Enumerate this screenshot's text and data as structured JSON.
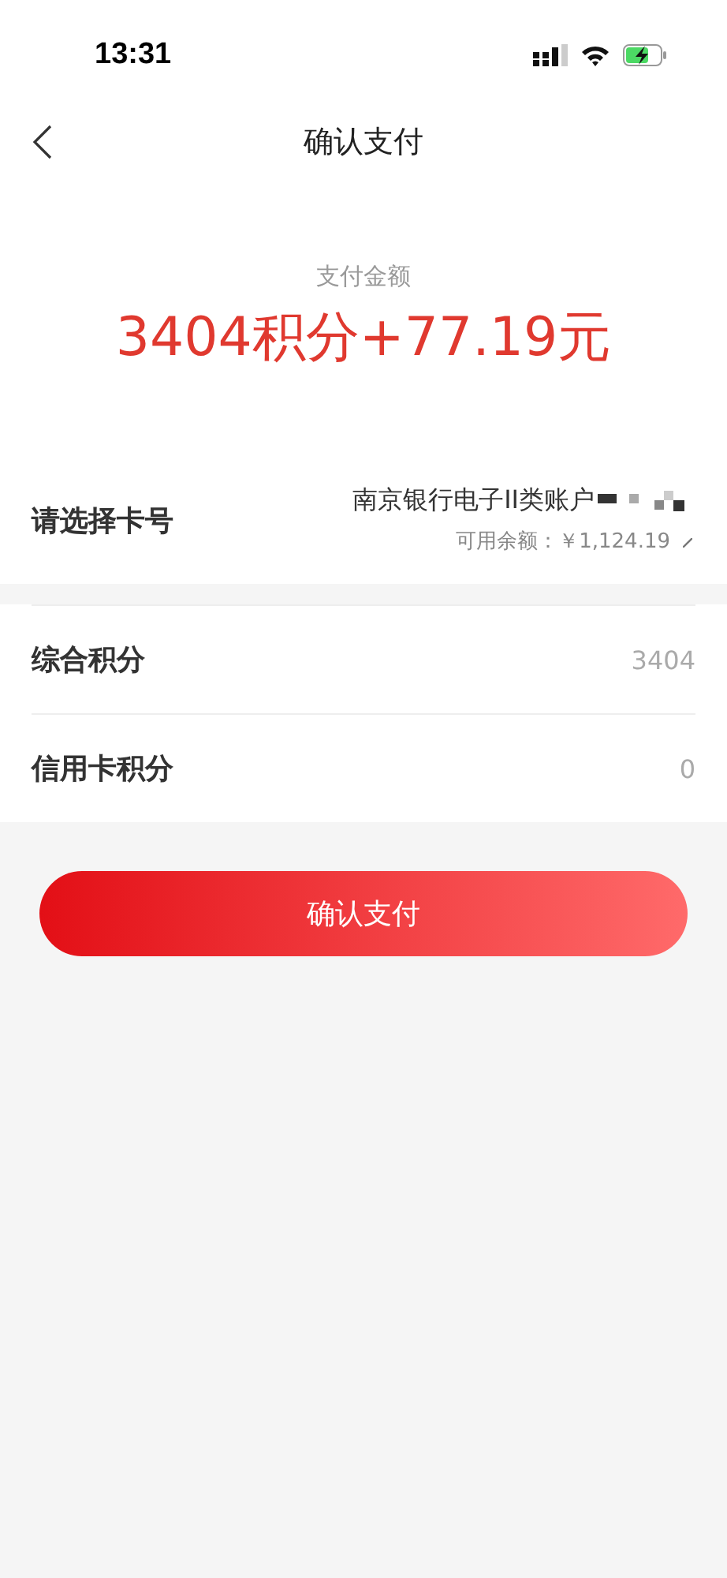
{
  "status_bar": {
    "time": "13:31"
  },
  "nav": {
    "title": "确认支付"
  },
  "amount": {
    "label": "支付金额",
    "value": "3404积分+77.19元"
  },
  "card": {
    "label": "请选择卡号",
    "account": "南京银行电子II类账户",
    "balance": "可用余额：￥1,124.19"
  },
  "points": [
    {
      "label": "综合积分",
      "value": "3404"
    },
    {
      "label": "信用卡积分",
      "value": "0"
    }
  ],
  "button": {
    "label": "确认支付"
  }
}
